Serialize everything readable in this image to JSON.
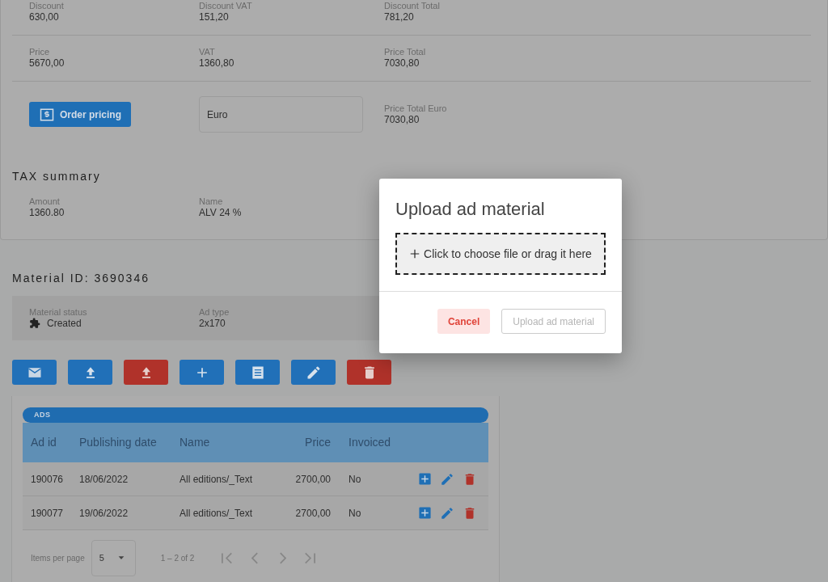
{
  "pricing": {
    "rows": [
      [
        {
          "label": "Discount",
          "value": "630,00"
        },
        {
          "label": "Discount VAT",
          "value": "151,20"
        },
        {
          "label": "Discount Total",
          "value": "781,20"
        }
      ],
      [
        {
          "label": "Price",
          "value": "5670,00"
        },
        {
          "label": "VAT",
          "value": "1360,80"
        },
        {
          "label": "Price Total",
          "value": "7030,80"
        }
      ]
    ],
    "order_pricing_button": "Order pricing",
    "currency_field": {
      "value": "Euro"
    },
    "price_total_euro": {
      "label": "Price Total Euro",
      "value": "7030,80"
    }
  },
  "tax_summary": {
    "title": "TAX summary",
    "fields": [
      {
        "label": "Amount",
        "value": "1360.80"
      },
      {
        "label": "Name",
        "value": "ALV 24 %"
      }
    ]
  },
  "material": {
    "title": "Material ID: 3690346",
    "status": {
      "label": "Material status",
      "value": "Created"
    },
    "ad_type": {
      "label": "Ad type",
      "value": "2x170"
    },
    "action_buttons": [
      {
        "color": "#2170b8"
      },
      {
        "color": "#2170b8"
      },
      {
        "color": "#b0322a"
      },
      {
        "color": "#2170b8"
      },
      {
        "color": "#2170b8"
      },
      {
        "color": "#2170b8"
      },
      {
        "color": "#b0322a"
      }
    ]
  },
  "ads_table": {
    "title": "ADS",
    "columns": [
      "Ad id",
      "Publishing date",
      "Name",
      "Price",
      "Invoiced"
    ],
    "rows": [
      [
        "190076",
        "18/06/2022",
        "All editions/_Text",
        "2700,00",
        "No"
      ],
      [
        "190077",
        "19/06/2022",
        "All editions/_Text",
        "2700,00",
        "No"
      ]
    ],
    "paginator": {
      "items_per_page_label": "Items per page",
      "page_size": "5",
      "range": "1 – 2 of 2",
      "buttons": [
        {
          "disabled": true
        },
        {
          "disabled": true
        },
        {
          "disabled": true
        },
        {
          "disabled": true
        }
      ]
    }
  },
  "dialog": {
    "title": "Upload ad material",
    "drop_zone": "Click to choose file or drag it here",
    "buttons": [
      {
        "label": "Cancel",
        "kind": "cancel",
        "disabled": false
      },
      {
        "label": "Upload ad material",
        "kind": "submit",
        "disabled": true
      }
    ]
  }
}
